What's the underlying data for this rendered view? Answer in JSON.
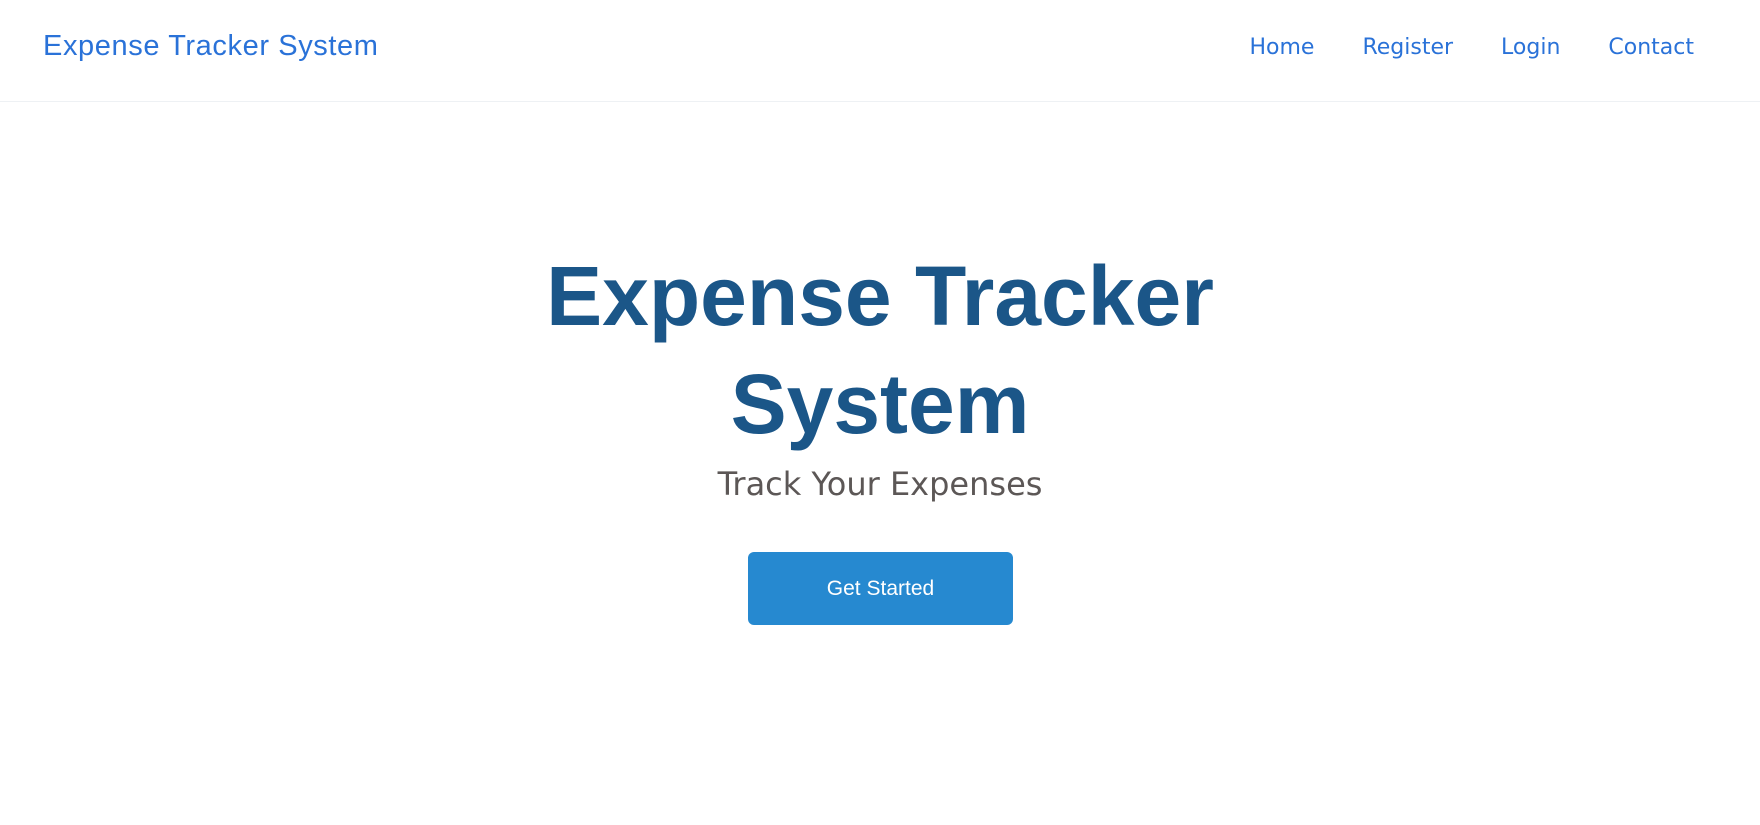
{
  "navbar": {
    "brand": "Expense Tracker System",
    "links": [
      {
        "label": "Home"
      },
      {
        "label": "Register"
      },
      {
        "label": "Login"
      },
      {
        "label": "Contact"
      }
    ]
  },
  "hero": {
    "title": "Expense Tracker System",
    "subtitle": "Track Your Expenses",
    "cta_label": "Get Started"
  },
  "colors": {
    "link": "#2a72d8",
    "title": "#1b5688",
    "subtitle": "#5c5756",
    "button": "#2689d0",
    "background": "#ffffff"
  }
}
